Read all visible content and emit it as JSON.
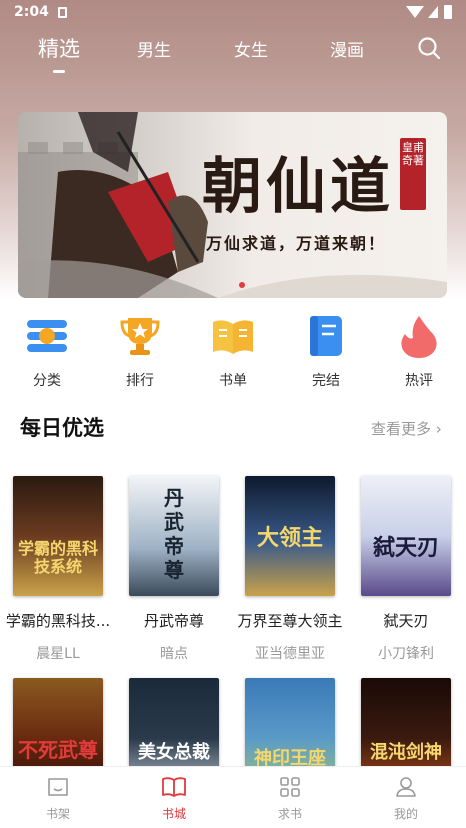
{
  "status_bar": {
    "time": "2:04"
  },
  "tabs": [
    {
      "label": "精选",
      "active": true
    },
    {
      "label": "男生",
      "active": false
    },
    {
      "label": "女生",
      "active": false
    },
    {
      "label": "漫画",
      "active": false
    }
  ],
  "banner": {
    "title": "朝仙道",
    "subtitle": "万仙求道，万道来朝！",
    "seal": "皇甫奇著",
    "page_count": 1,
    "active_page": 1
  },
  "categories": [
    {
      "label": "分类",
      "icon": "list-icon",
      "color": "#3b8ff0"
    },
    {
      "label": "排行",
      "icon": "trophy-icon",
      "color": "#f5a623"
    },
    {
      "label": "书单",
      "icon": "open-book-icon",
      "color": "#f5c242"
    },
    {
      "label": "完结",
      "icon": "notebook-icon",
      "color": "#3b8ff0"
    },
    {
      "label": "热评",
      "icon": "flame-icon",
      "color": "#f26b6b"
    }
  ],
  "section": {
    "title": "每日优选",
    "more": "查看更多"
  },
  "books": [
    {
      "title": "学霸的黑科技...",
      "author": "晨星LL",
      "cover_text": "学霸的黑科技系统",
      "cover_color": "#6b3b20"
    },
    {
      "title": "丹武帝尊",
      "author": "暗点",
      "cover_text": "丹武帝尊",
      "cover_color": "#9fb3c6"
    },
    {
      "title": "万界至尊大领主",
      "author": "亚当德里亚",
      "cover_text": "大领主",
      "cover_color": "#3a5a8a"
    },
    {
      "title": "弑天刃",
      "author": "小刀锋利",
      "cover_text": "弑天刃",
      "cover_color": "#c8d0e8"
    }
  ],
  "books_row2": [
    {
      "cover_text": "不死武尊",
      "cover_color": "#6a2a10"
    },
    {
      "cover_text": "美女总裁",
      "cover_color": "#2a3a4a"
    },
    {
      "cover_text": "神印王座",
      "cover_color": "#5a9ac8"
    },
    {
      "cover_text": "混沌剑神",
      "cover_color": "#3a1a10"
    }
  ],
  "bottom_nav": [
    {
      "label": "书架",
      "icon": "bookshelf-icon",
      "active": false
    },
    {
      "label": "书城",
      "icon": "book-icon",
      "active": true
    },
    {
      "label": "求书",
      "icon": "grid-icon",
      "active": false
    },
    {
      "label": "我的",
      "icon": "user-icon",
      "active": false
    }
  ],
  "colors": {
    "accent": "#e0393e",
    "hero_gradient": "#b08a84"
  }
}
